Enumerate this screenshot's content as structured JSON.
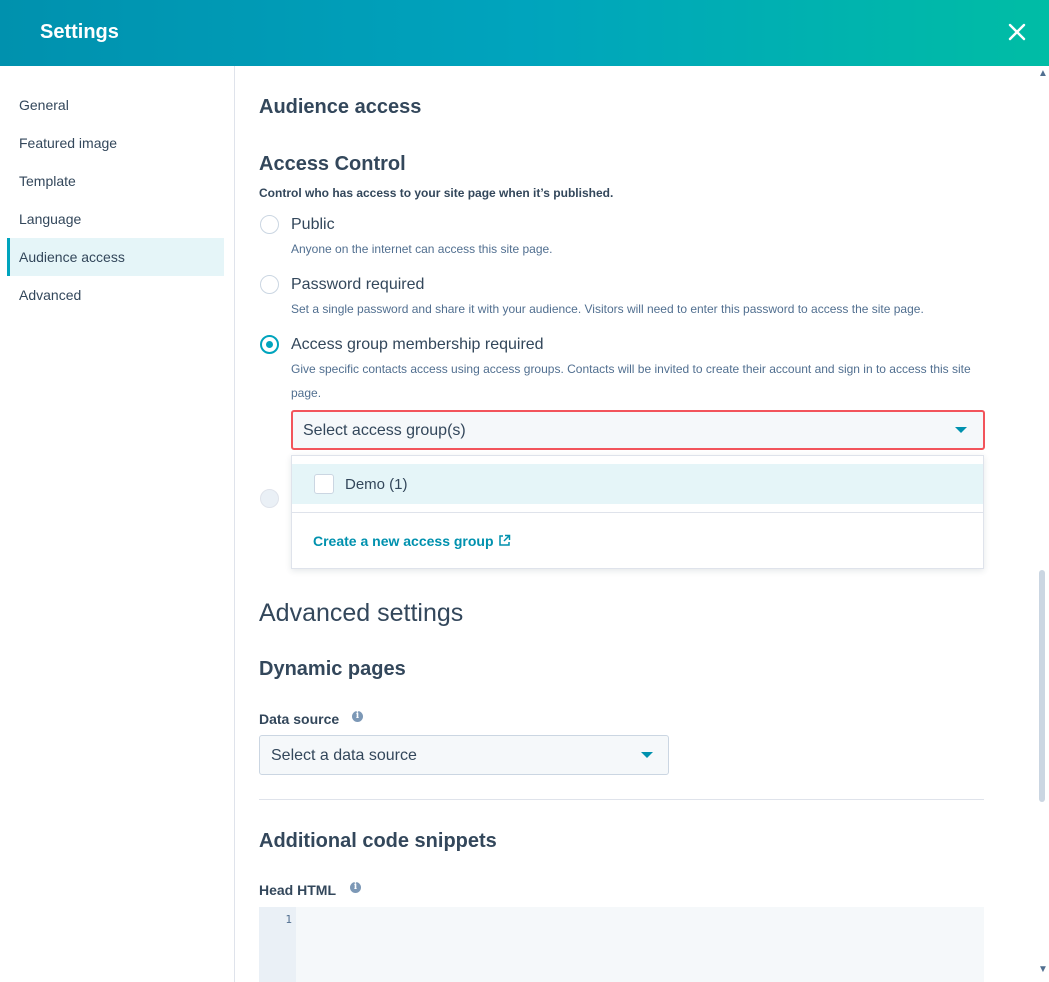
{
  "header": {
    "title": "Settings"
  },
  "sidebar": {
    "items": [
      {
        "label": "General"
      },
      {
        "label": "Featured image"
      },
      {
        "label": "Template"
      },
      {
        "label": "Language"
      },
      {
        "label": "Audience access",
        "active": true
      },
      {
        "label": "Advanced"
      }
    ]
  },
  "audience": {
    "title": "Audience access",
    "access_control_title": "Access Control",
    "help": "Control who has access to your site page when it’s published.",
    "options": [
      {
        "label": "Public",
        "desc": "Anyone on the internet can access this site page.",
        "checked": false
      },
      {
        "label": "Password required",
        "desc": "Set a single password and share it with your audience. Visitors will need to enter this password to access the site page.",
        "checked": false
      },
      {
        "label": "Access group membership required",
        "desc": "Give specific contacts access using access groups. Contacts will be invited to create their account and sign in to access this site page.",
        "checked": true
      }
    ],
    "group_select_placeholder": "Select access group(s)",
    "dropdown": {
      "options": [
        {
          "label": "Demo (1)",
          "checked": false
        }
      ],
      "create_link": "Create a new access group"
    }
  },
  "advanced": {
    "title": "Advanced settings",
    "dynamic_pages_title": "Dynamic pages",
    "data_source_label": "Data source",
    "data_source_placeholder": "Select a data source",
    "snippets_title": "Additional code snippets",
    "head_html_label": "Head HTML",
    "line_number": "1"
  },
  "colors": {
    "accent": "#00a4bd",
    "link": "#0091ae",
    "error": "#f2545b",
    "text": "#33475b"
  },
  "icons": {
    "close": "close-icon",
    "info": "info-icon",
    "external": "external-link-icon",
    "caret": "caret-down-icon"
  }
}
